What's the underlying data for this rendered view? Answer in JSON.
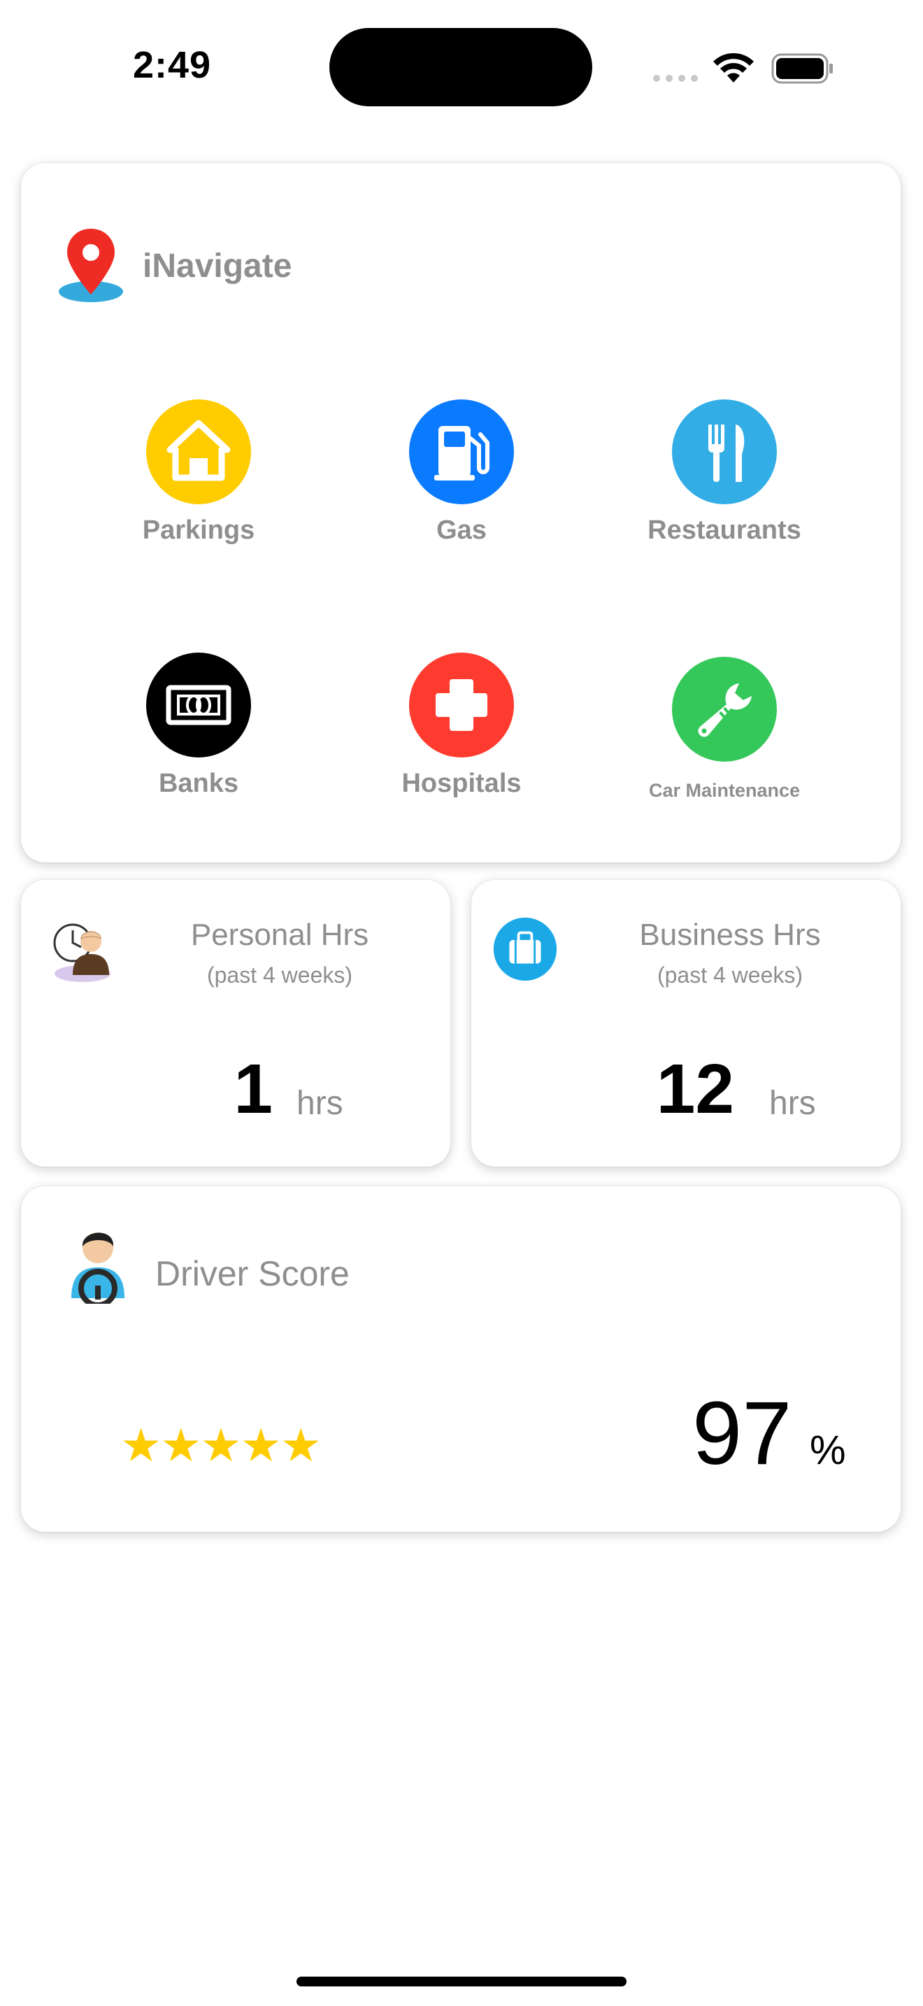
{
  "status_bar": {
    "time": "2:49"
  },
  "navigate": {
    "title": "iNavigate",
    "categories": [
      {
        "label": "Parkings",
        "icon": "home-icon",
        "color": "#ffcc00"
      },
      {
        "label": "Gas",
        "icon": "fuel-pump-icon",
        "color": "#0a7aff"
      },
      {
        "label": "Restaurants",
        "icon": "fork-knife-icon",
        "color": "#32ade6"
      },
      {
        "label": "Banks",
        "icon": "banknote-icon",
        "color": "#000000"
      },
      {
        "label": "Hospitals",
        "icon": "medical-cross-icon",
        "color": "#ff3b30"
      },
      {
        "label": "Car Maintenance",
        "icon": "wrench-icon",
        "color": "#34c759"
      }
    ]
  },
  "personal_hours": {
    "title": "Personal Hrs",
    "subtitle": "(past 4 weeks)",
    "value": "1",
    "unit": "hrs"
  },
  "business_hours": {
    "title": "Business Hrs",
    "subtitle": "(past 4 weeks)",
    "value": "12",
    "unit": "hrs"
  },
  "driver_score": {
    "title": "Driver Score",
    "stars": "★★★★★",
    "rating_stars": 5,
    "rating_max": 5,
    "value": "97",
    "unit": "%"
  }
}
